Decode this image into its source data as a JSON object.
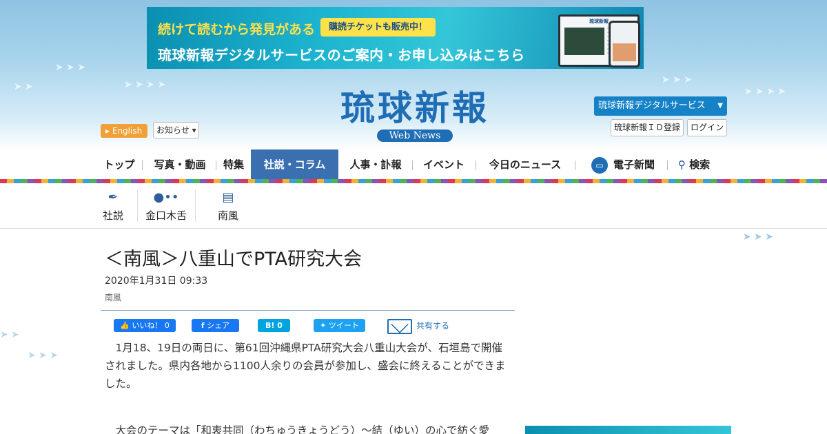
{
  "banner": {
    "headline1": "続けて読むから発見がある",
    "pill": "購読チケットも販売中！",
    "headline2": "琉球新報デジタルサービスのご案内・お申し込みはこちら",
    "screen_title": "琉球新報"
  },
  "header": {
    "logo": "琉球新報",
    "logo_sub": "Web News",
    "english_label": "English",
    "notice_label": "お知らせ",
    "digital_label": "琉球新報デジタルサービス",
    "id_register_label": "琉球新報ＩＤ登録",
    "login_label": "ログイン"
  },
  "nav": {
    "top": "トップ",
    "photo_video": "写真・動画",
    "feature": "特集",
    "editorial_column": "社説・コラム",
    "personnel_obit": "人事・訃報",
    "event": "イベント",
    "today_news": "今日のニュース",
    "e_paper": "電子新聞",
    "search": "検索"
  },
  "subnav": {
    "editorial": "社説",
    "kinkuchi": "金口木舌",
    "nanpu": "南風"
  },
  "article": {
    "title": "＜南風＞八重山でPTA研究大会",
    "date": "2020年1月31日 09:33",
    "category": "南風",
    "p1": "1月18、19日の両日に、第61回沖縄県PTA研究大会八重山大会が、石垣島で開催されました。県内各地から1100人余りの会員が参加し、盛会に終えることができました。",
    "p2": "大会のテーマは「和衷共同（わちゅうきょうどう）～結（ゆい）の心で紡ぐ愛"
  },
  "share": {
    "like": "いいね！ 0",
    "fb_share": "シェア",
    "hatena": "B! 0",
    "tweet": "ツイート",
    "mail": "共有する"
  },
  "colors": {
    "brand_blue": "#1f6db4",
    "nav_active": "#3a6fb0",
    "english_btn": "#f0a037",
    "facebook": "#1877f2",
    "twitter": "#1da1f2"
  }
}
